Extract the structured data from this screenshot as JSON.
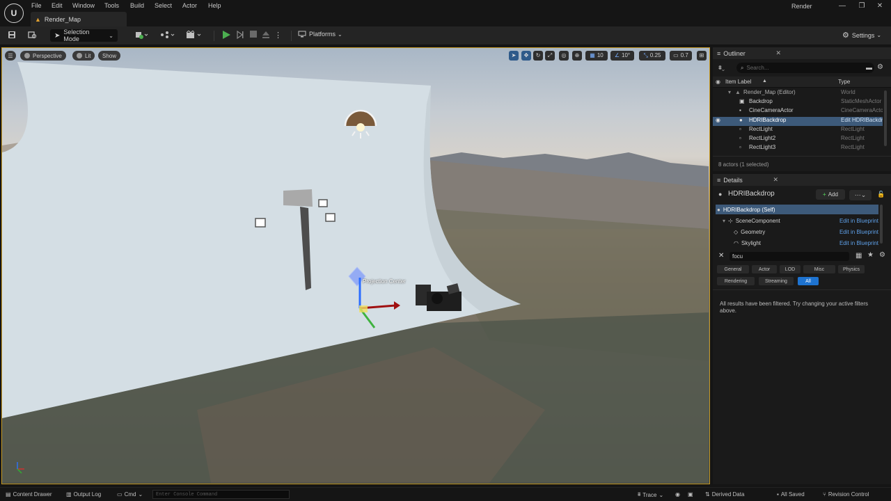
{
  "app": {
    "logo_text": "U"
  },
  "menu": [
    "File",
    "Edit",
    "Window",
    "Tools",
    "Build",
    "Select",
    "Actor",
    "Help"
  ],
  "window_title": "Render",
  "window_controls": {
    "minimize": "—",
    "restore": "❐",
    "close": "✕"
  },
  "level_tab": {
    "label": "Render_Map"
  },
  "toolbar": {
    "selection_mode": "Selection Mode",
    "platforms": "Platforms",
    "settings": "Settings"
  },
  "viewport": {
    "perspective": "Perspective",
    "lit": "Lit",
    "show": "Show",
    "grid_snap": "10",
    "rotation_snap": "10°",
    "scale_snap": "0.25",
    "camera_speed": "0.7",
    "projection_label": "Projection Center"
  },
  "outliner": {
    "title": "Outliner",
    "search_placeholder": "Search...",
    "col_label": "Item Label",
    "col_type": "Type",
    "rows": [
      {
        "label": "Render_Map (Editor)",
        "type": "World"
      },
      {
        "label": "Backdrop",
        "type": "StaticMeshActor"
      },
      {
        "label": "CineCameraActor",
        "type": "CineCameraActor"
      },
      {
        "label": "HDRIBackdrop",
        "type": "Edit HDRIBackdrop"
      },
      {
        "label": "RectLight",
        "type": "RectLight"
      },
      {
        "label": "RectLight2",
        "type": "RectLight"
      },
      {
        "label": "RectLight3",
        "type": "RectLight"
      }
    ],
    "count": "8 actors (1 selected)"
  },
  "details": {
    "title": "Details",
    "actor_name": "HDRIBackdrop",
    "add_label": "Add",
    "components": [
      {
        "label": "HDRIBackdrop (Self)",
        "edit": ""
      },
      {
        "label": "SceneComponent",
        "edit": "Edit in Blueprint"
      },
      {
        "label": "Geometry",
        "edit": "Edit in Blueprint"
      },
      {
        "label": "Skylight",
        "edit": "Edit in Blueprint"
      }
    ],
    "search_value": "focu",
    "filters_row1": [
      "General",
      "Actor",
      "LOD",
      "Misc",
      "Physics"
    ],
    "filters_row2": [
      "Rendering",
      "Streaming",
      "All"
    ],
    "filtered_message": "All results have been filtered. Try changing your active filters above."
  },
  "statusbar": {
    "content_drawer": "Content Drawer",
    "output_log": "Output Log",
    "cmd": "Cmd",
    "console_placeholder": "Enter Console Command",
    "trace": "Trace",
    "derived_data": "Derived Data",
    "all_saved": "All Saved",
    "revision_control": "Revision Control"
  },
  "colors": {
    "accent_blue": "#1e73d0",
    "viewport_border": "#c79a24",
    "play_green": "#4caf50",
    "selection_row": "#3d5a7a"
  }
}
